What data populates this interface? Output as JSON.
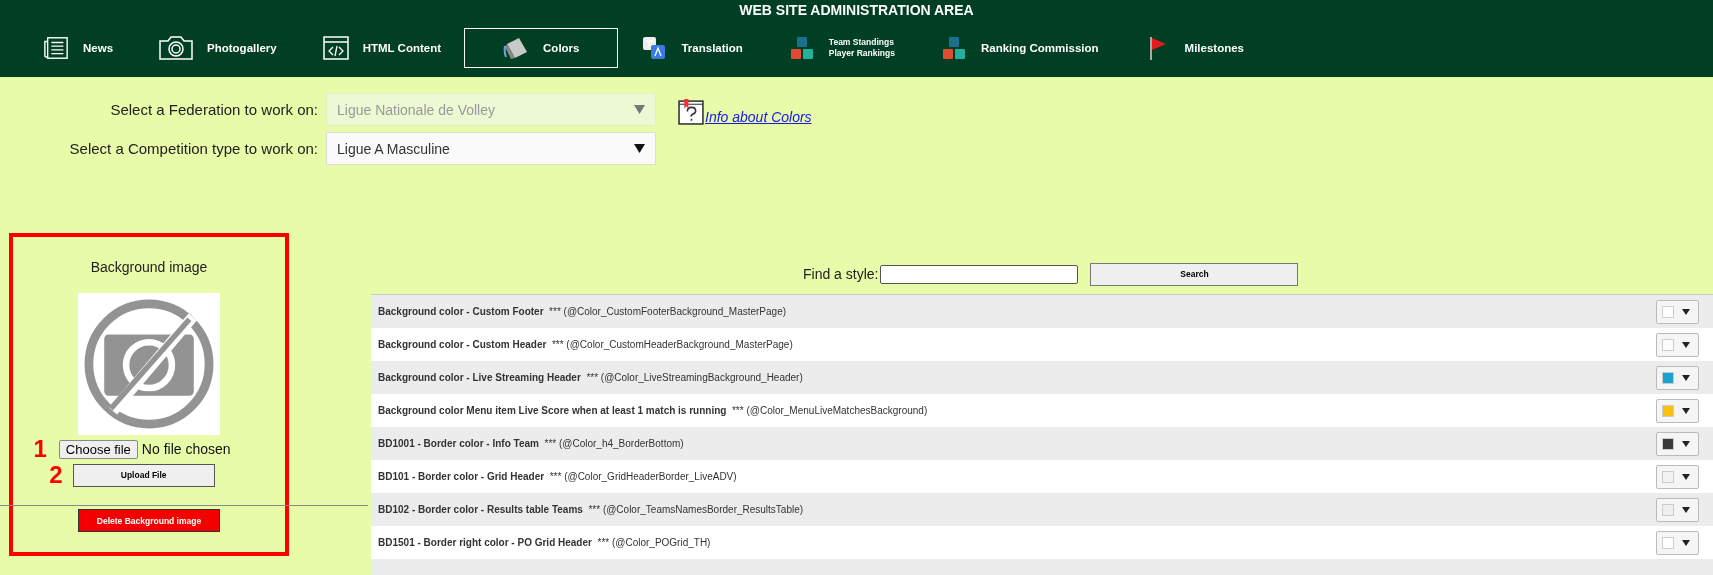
{
  "header": {
    "title": "WEB SITE ADMINISTRATION AREA"
  },
  "nav": [
    {
      "label": "News",
      "kind": "news",
      "selected": false
    },
    {
      "label": "Photogallery",
      "kind": "camera",
      "selected": false
    },
    {
      "label": "HTML Content",
      "kind": "code",
      "selected": false
    },
    {
      "label": "Colors",
      "kind": "bucket",
      "selected": true
    },
    {
      "label": "Translation",
      "kind": "translate",
      "selected": false
    },
    {
      "label": "Team Standings\nPlayer Rankings",
      "kind": "blocks",
      "selected": false
    },
    {
      "label": "Ranking Commission",
      "kind": "blocks",
      "selected": false
    },
    {
      "label": "Milestones",
      "kind": "flag",
      "selected": false
    }
  ],
  "selectors": [
    {
      "label": "Select a Federation to work on:",
      "value": "Ligue Nationale de Volley",
      "disabled": true
    },
    {
      "label": "Select a Competition type to work on:",
      "value": "Ligue A Masculine",
      "disabled": false
    }
  ],
  "info_link": "Info about Colors",
  "background_panel": {
    "title": "Background image",
    "marker_1": "1",
    "choose_button": "Choose file",
    "file_status": "No file chosen",
    "marker_2": "2",
    "upload_button": "Upload File",
    "delete_button": "Delete Background image"
  },
  "search": {
    "label": "Find a style:",
    "button": "Search"
  },
  "styles": [
    {
      "name": "Background color - Custom Footer",
      "variable": "*** (@Color_CustomFooterBackground_MasterPage)",
      "color": "#ffffff"
    },
    {
      "name": "Background color - Custom Header",
      "variable": "*** (@Color_CustomHeaderBackground_MasterPage)",
      "color": "#fcfcfc"
    },
    {
      "name": "Background color - Live Streaming Header",
      "variable": "*** (@Color_LiveStreamingBackground_Header)",
      "color": "#1aa3cf"
    },
    {
      "name": "Background color Menu item Live Score when at least 1 match is running",
      "variable": "*** (@Color_MenuLiveMatchesBackground)",
      "color": "#f9bf13"
    },
    {
      "name": "BD1001 - Border color - Info Team",
      "variable": "*** (@Color_h4_BorderBottom)",
      "color": "#3a3a3a"
    },
    {
      "name": "BD101 - Border color - Grid Header",
      "variable": "*** (@Color_GridHeaderBorder_LiveADV)",
      "color": "#f2f2f2"
    },
    {
      "name": "BD102 - Border color - Results table Teams",
      "variable": "*** (@Color_TeamsNamesBorder_ResultsTable)",
      "color": "#efefef"
    },
    {
      "name": "BD1501 - Border right color - PO Grid Header",
      "variable": "*** (@Color_POGrid_TH)",
      "color": "#ffffff"
    }
  ]
}
